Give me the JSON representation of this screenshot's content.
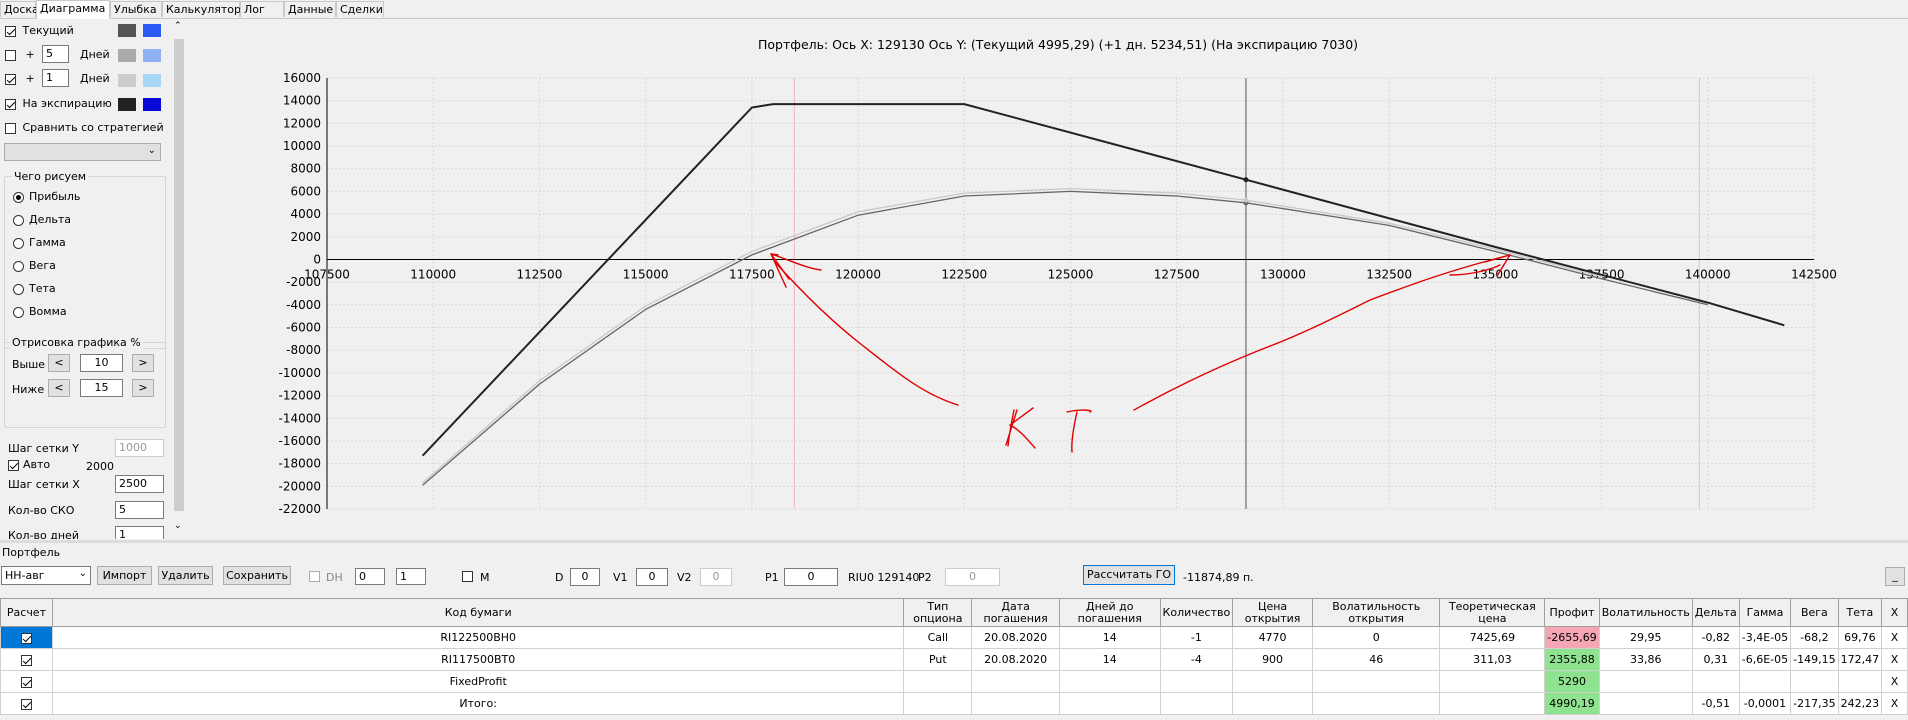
{
  "tabs": [
    "Доска",
    "Диаграмма",
    "Улыбка",
    "Калькулятор",
    "Лог",
    "Данные",
    "Сделки"
  ],
  "left": {
    "rows": [
      {
        "label": "Текущий",
        "checked": true,
        "colors": [
          "#555555",
          "#2a5cf5"
        ]
      },
      {
        "plus": "+",
        "days_value": "5",
        "days_label": "Дней",
        "checked": false,
        "colors": [
          "#aaaaaa",
          "#8fb1f2"
        ]
      },
      {
        "plus": "+",
        "days_value": "1",
        "days_label": "Дней",
        "checked": true,
        "colors": [
          "#cccccc",
          "#a8d6f7"
        ]
      },
      {
        "label": "На экспирацию",
        "checked": true,
        "colors": [
          "#222222",
          "#0a0ad8"
        ]
      }
    ],
    "compare_label": "Сравнить со стратегией",
    "what_group": "Чего рисуем",
    "what_options": [
      "Прибыль",
      "Дельта",
      "Гамма",
      "Вега",
      "Тета",
      "Вомма"
    ],
    "selected_option": "Прибыль",
    "draw_group": "Отрисовка графика %",
    "above_label": "Выше",
    "above_value": "10",
    "below_label": "Ниже",
    "below_value": "15",
    "prev_btn": "<",
    "next_btn": ">",
    "grid_y_label": "Шаг сетки Y",
    "grid_y_value": "1000",
    "auto_label": "Авто",
    "auto_value": "2000",
    "grid_x_label": "Шаг сетки X",
    "grid_x_value": "2500",
    "sko_label": "Кол-во СКО",
    "sko_value": "5",
    "days_count_label": "Кол-во дней",
    "days_count_value": "1"
  },
  "chart_title": "Портфель: Ось X: 129130 Ось Y:  (Текущий 4995,29)  (+1 дн. 5234,51)  (На экспирацию 7030)",
  "chart_data": {
    "type": "line",
    "xlim": [
      107500,
      142500
    ],
    "ylim": [
      -22000,
      16000
    ],
    "x_ticks": [
      107500,
      110000,
      112500,
      115000,
      117500,
      120000,
      122500,
      125000,
      127500,
      130000,
      132500,
      135000,
      137500,
      140000,
      142500
    ],
    "y_ticks": [
      16000,
      14000,
      12000,
      10000,
      8000,
      6000,
      4000,
      2000,
      0,
      -2000,
      -4000,
      -6000,
      -8000,
      -10000,
      -12000,
      -14000,
      -16000,
      -18000,
      -20000,
      -22000
    ],
    "vertical_lines": [
      {
        "x": 118500,
        "color": "#f5b5c2"
      },
      {
        "x": 129130,
        "color": "#555555"
      },
      {
        "x": 139800,
        "color": "#f5b5c2"
      }
    ],
    "series": [
      {
        "color": "#222222",
        "points": [
          [
            109750,
            -17300
          ],
          [
            117500,
            13400
          ],
          [
            118000,
            13700
          ],
          [
            122500,
            13700
          ],
          [
            129130,
            7030
          ],
          [
            135000,
            1100
          ],
          [
            140000,
            -3800
          ],
          [
            141800,
            -5800
          ]
        ]
      },
      {
        "color": "#666666",
        "points": [
          [
            109750,
            -19900
          ],
          [
            112500,
            -11000
          ],
          [
            115000,
            -4400
          ],
          [
            117500,
            400
          ],
          [
            120000,
            3900
          ],
          [
            122500,
            5600
          ],
          [
            125000,
            6000
          ],
          [
            127500,
            5600
          ],
          [
            129130,
            4995
          ],
          [
            132500,
            3000
          ],
          [
            135000,
            700
          ],
          [
            137500,
            -1700
          ],
          [
            140000,
            -4000
          ]
        ]
      },
      {
        "color": "#c8c8c8",
        "points": [
          [
            109750,
            -19700
          ],
          [
            112500,
            -10700
          ],
          [
            115000,
            -4100
          ],
          [
            117500,
            700
          ],
          [
            120000,
            4200
          ],
          [
            122500,
            5850
          ],
          [
            125000,
            6250
          ],
          [
            127500,
            5850
          ],
          [
            129130,
            5234
          ],
          [
            132500,
            3200
          ],
          [
            135000,
            900
          ],
          [
            137500,
            -1500
          ]
        ]
      }
    ],
    "annotations": [
      "КТ"
    ]
  },
  "bottom": {
    "title": "Портфель",
    "portfolio_select": "НН-авг",
    "import_btn": "Импорт",
    "delete_btn": "Удалить",
    "save_btn": "Сохранить",
    "dh_label": "DH",
    "dh_v1": "0",
    "dh_v2": "1",
    "m_label": "M",
    "d_label": "D",
    "d_value": "0",
    "v1_label": "V1",
    "v1_value": "0",
    "v2_label": "V2",
    "v2_value": "0",
    "p1_label": "P1",
    "p1_value": "0",
    "riu_label": "RIU0 129140",
    "p2_label": "P2",
    "p2_value": "0",
    "calc_btn": "Рассчитать ГО",
    "go_value": "-11874,89 п.",
    "min_btn": "_"
  },
  "table": {
    "headers": [
      "Расчет",
      "Код бумаги",
      "Тип опциона",
      "Дата погашения",
      "Дней до погашения",
      "Количество",
      "Цена открытия",
      "Волатильность открытия",
      "Теоретическая цена",
      "Профит",
      "Волатильность",
      "Дельта",
      "Гамма",
      "Вега",
      "Тета",
      "X"
    ],
    "rows": [
      {
        "checked": true,
        "code": "RI122500BH0",
        "type": "Call",
        "date": "20.08.2020",
        "days": "14",
        "qty": "-1",
        "open_price": "4770",
        "open_vol": "0",
        "theo": "7425,69",
        "profit": "-2655,69",
        "vol": "29,95",
        "delta": "-0,82",
        "gamma": "-3,4E-05",
        "vega": "-68,2",
        "theta": "69,76",
        "x": "X"
      },
      {
        "checked": true,
        "code": "RI117500BT0",
        "type": "Put",
        "date": "20.08.2020",
        "days": "14",
        "qty": "-4",
        "open_price": "900",
        "open_vol": "46",
        "theo": "311,03",
        "profit": "2355,88",
        "vol": "33,86",
        "delta": "0,31",
        "gamma": "-6,6E-05",
        "vega": "-149,15",
        "theta": "172,47",
        "x": "X"
      },
      {
        "checked": true,
        "code": "FixedProfit",
        "type": "",
        "date": "",
        "days": "",
        "qty": "",
        "open_price": "",
        "open_vol": "",
        "theo": "",
        "profit": "5290",
        "vol": "",
        "delta": "",
        "gamma": "",
        "vega": "",
        "theta": "",
        "x": "X"
      },
      {
        "checked": true,
        "code": "Итого:",
        "type": "",
        "date": "",
        "days": "",
        "qty": "",
        "open_price": "",
        "open_vol": "",
        "theo": "",
        "profit": "4990,19",
        "vol": "",
        "delta": "-0,51",
        "gamma": "-0,0001",
        "vega": "-217,35",
        "theta": "242,23",
        "x": "X"
      }
    ]
  }
}
